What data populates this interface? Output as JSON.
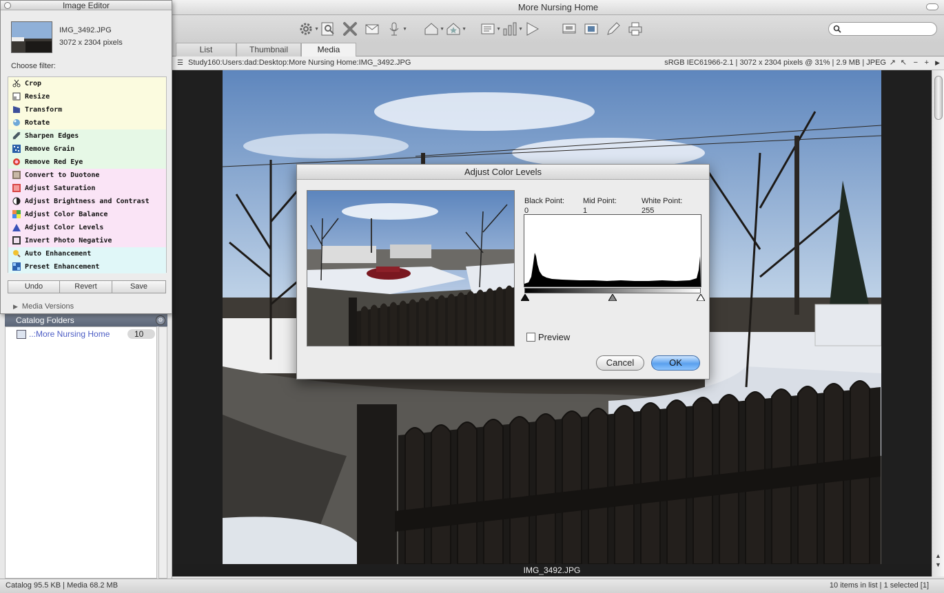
{
  "window": {
    "title": "More Nursing Home"
  },
  "tabs": [
    {
      "label": "List"
    },
    {
      "label": "Thumbnail"
    },
    {
      "label": "Media"
    }
  ],
  "path_bar": {
    "path": "Study160:Users:dad:Desktop:More Nursing Home:IMG_3492.JPG",
    "info": "sRGB IEC61966-2.1  |  3072 x 2304 pixels @ 31%  |  2.9 MB  |  JPEG"
  },
  "viewer": {
    "caption": "IMG_3492.JPG"
  },
  "status_bar": {
    "left": "Catalog  95.5 KB  |  Media 68.2 MB",
    "right": "10 items in list  |  1 selected [1]"
  },
  "image_editor": {
    "title": "Image Editor",
    "filename": "IMG_3492.JPG",
    "dimensions": "3072 x 2304 pixels",
    "choose_label": "Choose filter:",
    "filters": [
      {
        "label": "Crop",
        "icon": "scissors-icon"
      },
      {
        "label": "Resize",
        "icon": "resize-icon"
      },
      {
        "label": "Transform",
        "icon": "transform-icon"
      },
      {
        "label": "Rotate",
        "icon": "rotate-icon"
      },
      {
        "label": "Sharpen Edges",
        "icon": "sharpen-icon"
      },
      {
        "label": "Remove Grain",
        "icon": "grain-icon"
      },
      {
        "label": "Remove Red Eye",
        "icon": "red-eye-icon"
      },
      {
        "label": "Convert to Duotone",
        "icon": "duotone-icon"
      },
      {
        "label": "Adjust Saturation",
        "icon": "saturation-icon"
      },
      {
        "label": "Adjust Brightness and Contrast",
        "icon": "contrast-icon"
      },
      {
        "label": "Adjust Color Balance",
        "icon": "color-balance-icon"
      },
      {
        "label": "Adjust Color Levels",
        "icon": "color-levels-icon"
      },
      {
        "label": "Invert Photo Negative",
        "icon": "negative-icon"
      },
      {
        "label": "Auto Enhancement",
        "icon": "auto-enhance-icon"
      },
      {
        "label": "Preset Enhancement",
        "icon": "preset-enhance-icon"
      }
    ],
    "undo_label": "Undo",
    "revert_label": "Revert",
    "save_label": "Save",
    "media_versions_label": "Media Versions"
  },
  "catalog": {
    "header": "Catalog Folders",
    "folders": [
      {
        "name": "..:More Nursing Home",
        "count": "10"
      }
    ]
  },
  "dialog": {
    "title": "Adjust Color Levels",
    "black_label": "Black Point:",
    "black_value": "0",
    "mid_label": "Mid Point:",
    "mid_value": "1",
    "white_label": "White Point:",
    "white_value": "255",
    "preview_label": "Preview",
    "preview_checked": false,
    "cancel_label": "Cancel",
    "ok_label": "OK"
  },
  "colors": {
    "accent": "#5aa0ee",
    "catalog_link": "#4b5cc4"
  }
}
